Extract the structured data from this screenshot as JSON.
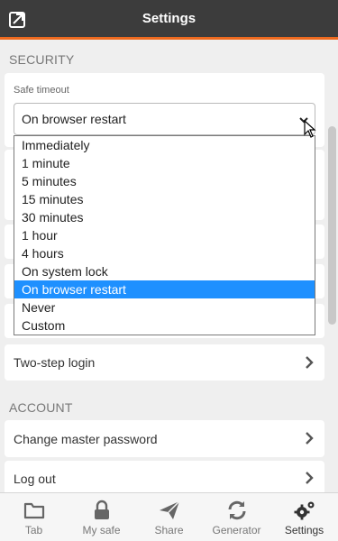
{
  "header": {
    "title": "Settings",
    "popout_icon": "popout-icon"
  },
  "security": {
    "section_title": "SECURITY",
    "safe_timeout_label": "Safe timeout",
    "safe_timeout_value": "On browser restart",
    "options": [
      "Immediately",
      "1 minute",
      "5 minutes",
      "15 minutes",
      "30 minutes",
      "1 hour",
      "4 hours",
      "On system lock",
      "On browser restart",
      "Never",
      "Custom"
    ],
    "selected_option": "On browser restart",
    "two_step_login": "Two-step login"
  },
  "account": {
    "section_title": "ACCOUNT",
    "change_master_password": "Change master password",
    "log_out": "Log out"
  },
  "tabs": [
    {
      "label": "Tab",
      "icon": "folder-icon"
    },
    {
      "label": "My safe",
      "icon": "lock-icon"
    },
    {
      "label": "Share",
      "icon": "send-icon"
    },
    {
      "label": "Generator",
      "icon": "refresh-icon"
    },
    {
      "label": "Settings",
      "icon": "gears-icon",
      "active": true
    }
  ],
  "colors": {
    "header_bg": "#3c3c3c",
    "accent": "#ee6a1f",
    "selected": "#1e90ff"
  }
}
